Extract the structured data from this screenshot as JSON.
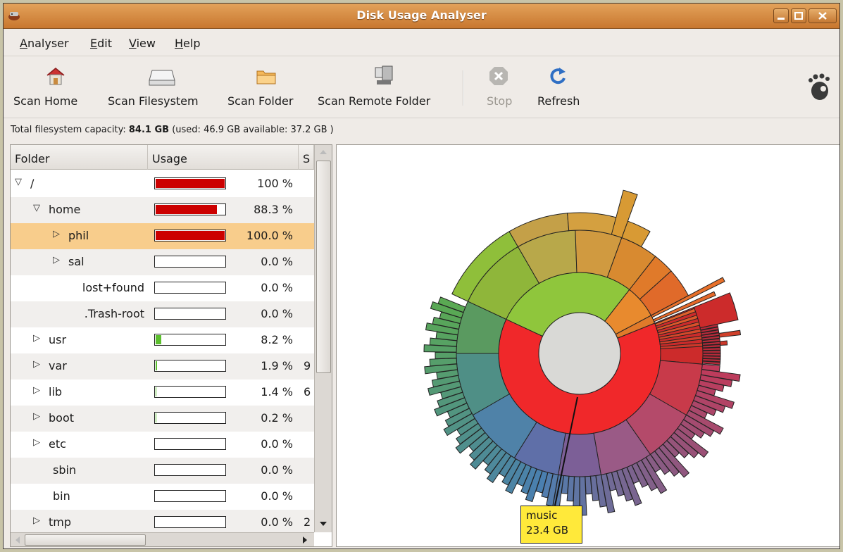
{
  "window": {
    "title": "Disk Usage Analyser"
  },
  "menu": {
    "analyser_rest": "nalyser",
    "analyser_mnemonic": "A",
    "edit_rest": "dit",
    "edit_mnemonic": "E",
    "view_rest": "iew",
    "view_mnemonic": "V",
    "help_rest": "elp",
    "help_mnemonic": "H"
  },
  "toolbar": {
    "scan_home": "Scan Home",
    "scan_filesystem": "Scan Filesystem",
    "scan_folder": "Scan Folder",
    "scan_remote": "Scan Remote Folder",
    "stop": "Stop",
    "refresh": "Refresh"
  },
  "capacity": {
    "prefix": "Total filesystem capacity:",
    "total": "84.1 GB",
    "detail": "(used: 46.9 GB available: 37.2 GB )"
  },
  "tree": {
    "col_folder": "Folder",
    "col_usage": "Usage",
    "col_size_partial": "S",
    "rows": [
      {
        "name": "/",
        "expander": "open",
        "pct": "100 %",
        "fill": 1.0,
        "color": "#cc0000",
        "extra": ""
      },
      {
        "name": "home",
        "expander": "open",
        "pct": "88.3 %",
        "fill": 0.883,
        "color": "#cc0000",
        "extra": ""
      },
      {
        "name": "phil",
        "expander": "closed",
        "pct": "100.0 %",
        "fill": 1.0,
        "color": "#cc0000",
        "extra": ""
      },
      {
        "name": "sal",
        "expander": "closed",
        "pct": "0.0 %",
        "fill": 0.0,
        "color": "#cc0000",
        "extra": ""
      },
      {
        "name": "lost+found",
        "expander": "none",
        "pct": "0.0 %",
        "fill": 0.0,
        "color": "#cc0000",
        "extra": ""
      },
      {
        "name": ".Trash-root",
        "expander": "none",
        "pct": "0.0 %",
        "fill": 0.0,
        "color": "#cc0000",
        "extra": ""
      },
      {
        "name": "usr",
        "expander": "closed",
        "pct": "8.2 %",
        "fill": 0.082,
        "color": "#5cbf2e",
        "extra": ""
      },
      {
        "name": "var",
        "expander": "closed",
        "pct": "1.9 %",
        "fill": 0.019,
        "color": "#5cbf2e",
        "extra": "9"
      },
      {
        "name": "lib",
        "expander": "closed",
        "pct": "1.4 %",
        "fill": 0.014,
        "color": "#5cbf2e",
        "extra": "6"
      },
      {
        "name": "boot",
        "expander": "closed",
        "pct": "0.2 %",
        "fill": 0.002,
        "color": "#5cbf2e",
        "extra": ""
      },
      {
        "name": "etc",
        "expander": "closed",
        "pct": "0.0 %",
        "fill": 0.0,
        "color": "#5cbf2e",
        "extra": ""
      },
      {
        "name": "sbin",
        "expander": "none",
        "pct": "0.0 %",
        "fill": 0.0,
        "color": "#5cbf2e",
        "extra": ""
      },
      {
        "name": "bin",
        "expander": "none",
        "pct": "0.0 %",
        "fill": 0.0,
        "color": "#5cbf2e",
        "extra": ""
      },
      {
        "name": "tmp",
        "expander": "closed",
        "pct": "0.0 %",
        "fill": 0.0,
        "color": "#5cbf2e",
        "extra": "2"
      }
    ]
  },
  "tooltip": {
    "name": "music",
    "size": "23.4 GB"
  },
  "colors": {
    "selection": "#f8cd8c",
    "usage_bar": "#cc0000",
    "title_bar": "#d88b43"
  }
}
